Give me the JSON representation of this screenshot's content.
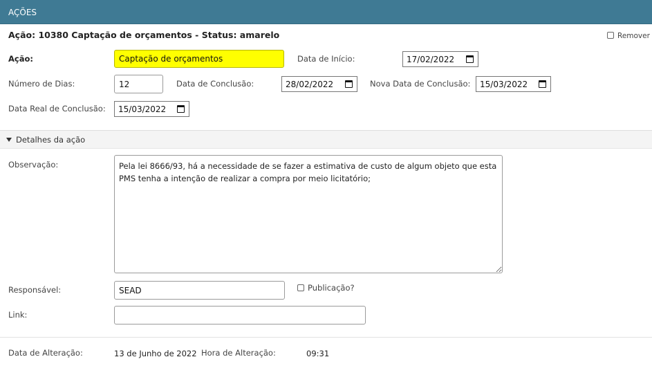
{
  "header": {
    "title": "AÇÕES"
  },
  "action": {
    "title": "Ação: 10380 Captação de orçamentos - Status: amarelo",
    "remove_label": "Remover"
  },
  "form": {
    "acao_label": "Ação:",
    "acao_value": "Captação de orçamentos",
    "data_inicio_label": "Data de Início:",
    "data_inicio_value": "17/02/2022",
    "numero_dias_label": "Número de Dias:",
    "numero_dias_value": "12",
    "data_conclusao_label": "Data de Conclusão:",
    "data_conclusao_value": "28/02/2022",
    "nova_data_label": "Nova Data de Conclusão:",
    "nova_data_value": "15/03/2022",
    "data_real_label": "Data Real de Conclusão:",
    "data_real_value": "15/03/2022"
  },
  "details": {
    "section_label": "Detalhes da ação",
    "observacao_label": "Observação:",
    "observacao_value": "Pela lei 8666/93, há a necessidade de se fazer a estimativa de custo de algum objeto que esta PMS tenha a intenção de realizar a compra por meio licitatório;",
    "responsavel_label": "Responsável:",
    "responsavel_value": "SEAD",
    "publicacao_label": "Publicação?",
    "link_label": "Link:",
    "link_value": ""
  },
  "footer": {
    "data_alteracao_label": "Data de Alteração:",
    "data_alteracao_value": "13 de Junho de 2022",
    "hora_alteracao_label": "Hora de Alteração:",
    "hora_alteracao_value": "09:31"
  }
}
